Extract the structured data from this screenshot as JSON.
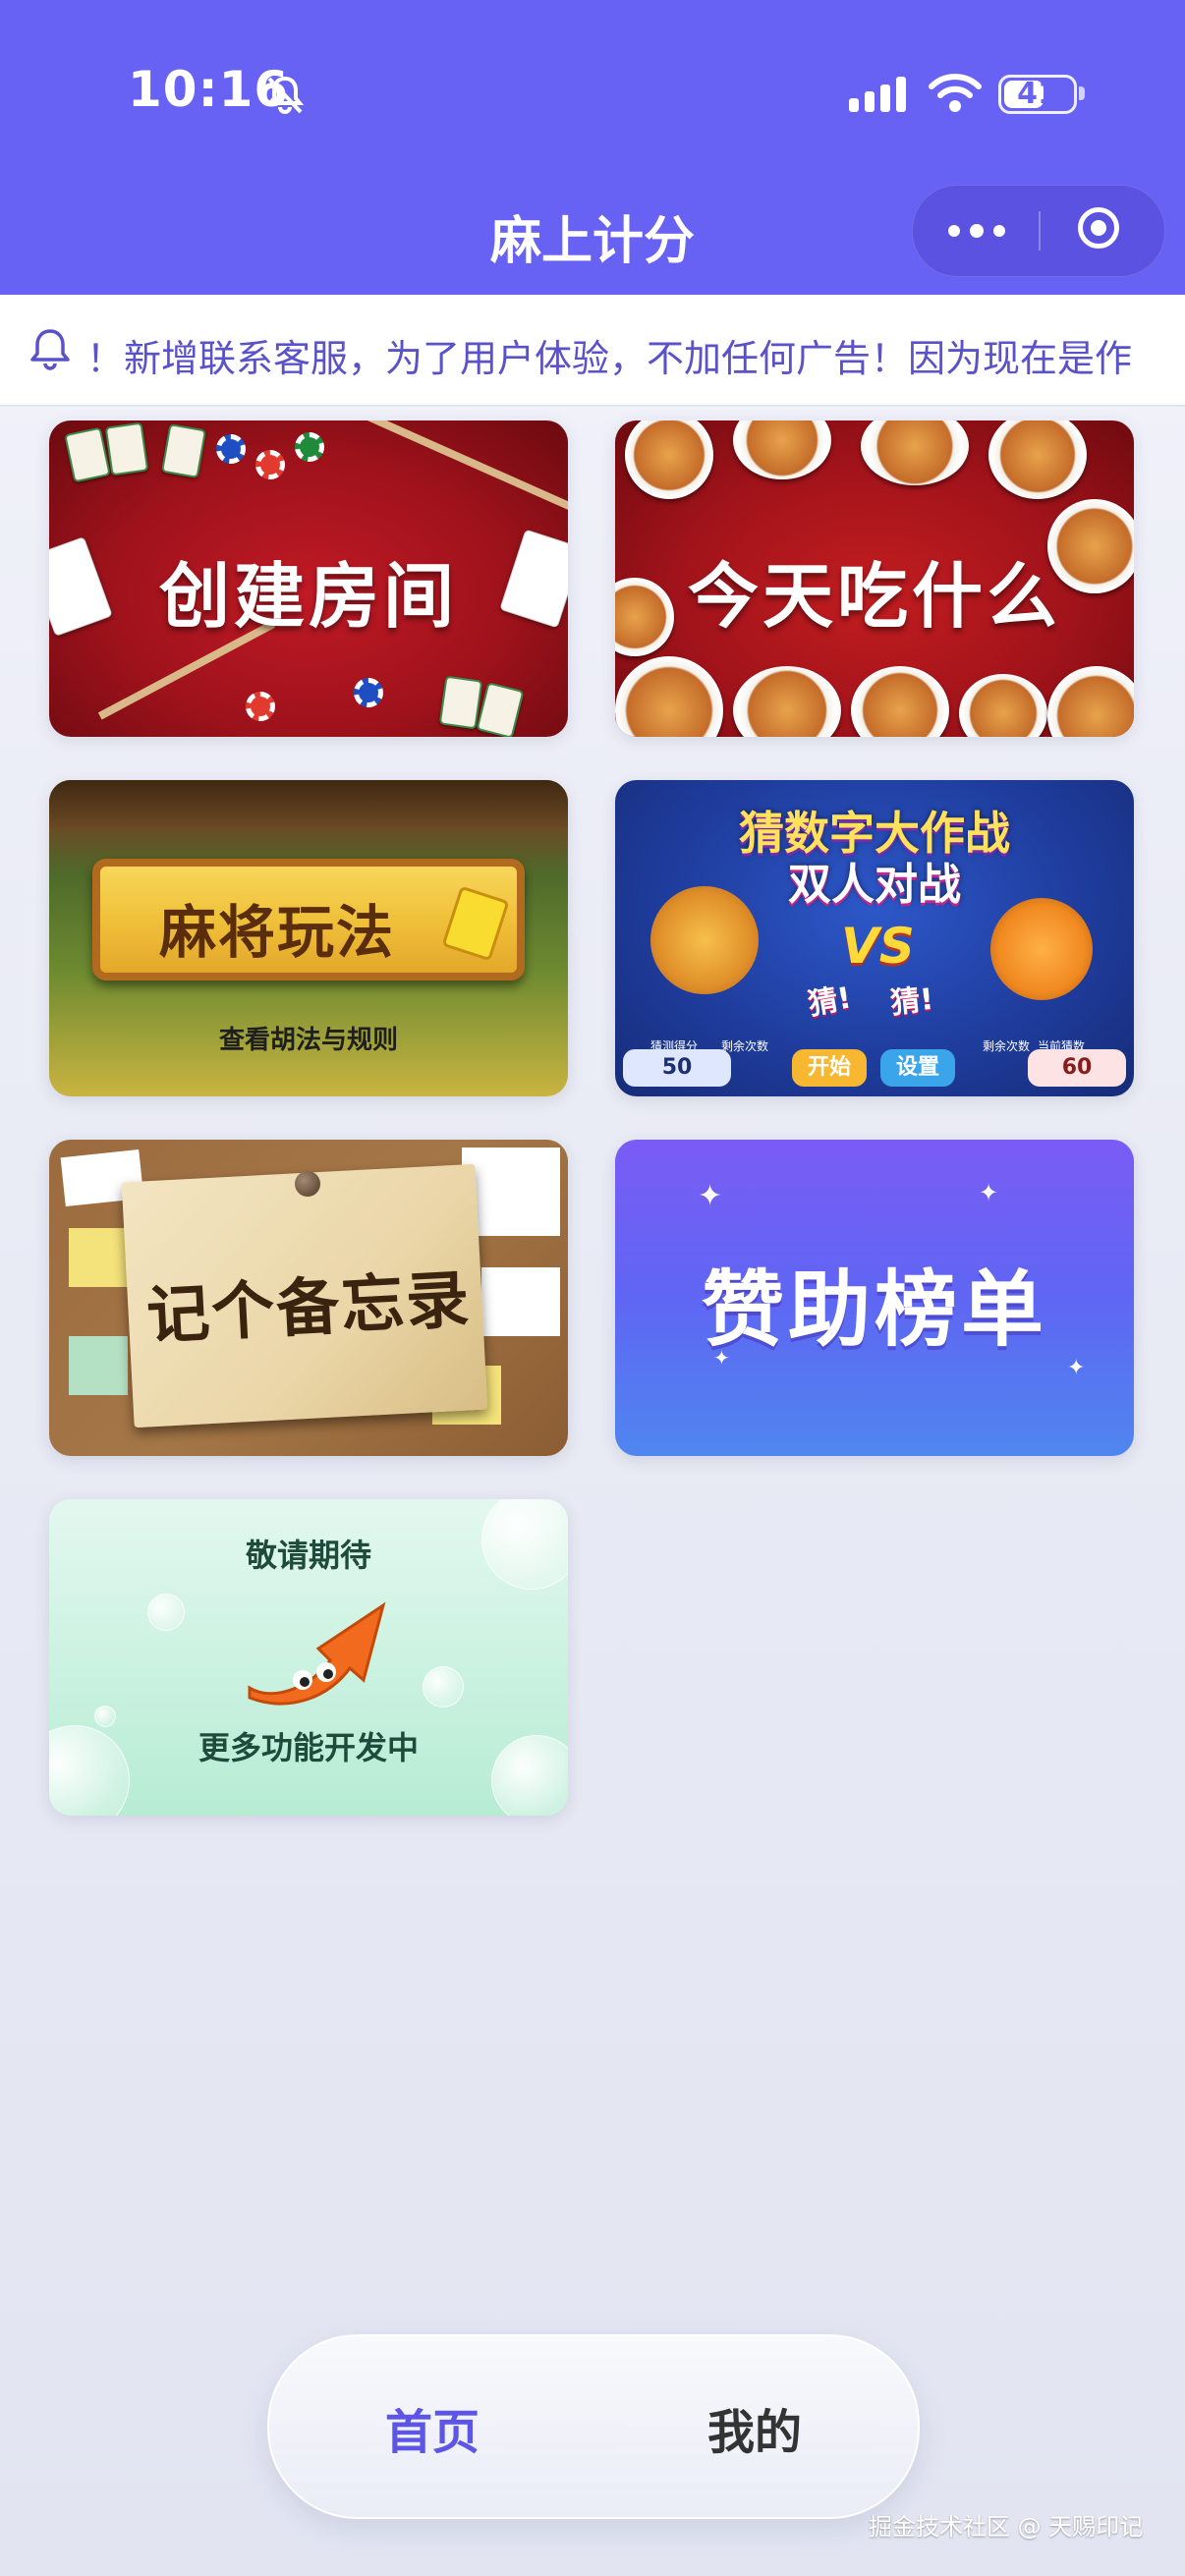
{
  "status_bar": {
    "time": "10:16",
    "battery": "41"
  },
  "app": {
    "title": "麻上计分"
  },
  "notice": {
    "text": "！新增联系客服，为了用户体验，不加任何广告！因为现在是作"
  },
  "cards": {
    "create_room": {
      "label": "创建房间"
    },
    "what_to_eat": {
      "label": "今天吃什么"
    },
    "mahjong_rules": {
      "label": "麻将玩法",
      "subtitle": "查看胡法与规则"
    },
    "guess_number": {
      "title_line1": "猜数字大作战",
      "title_line2": "双人对战",
      "vs": "VS",
      "guess1": "猜!",
      "guess2": "猜!",
      "left_caption": "猜测得分",
      "left_score": "50",
      "left_remaining": "剩余次数",
      "start": "开始",
      "settings": "设置",
      "right_remaining": "剩余次数",
      "right_caption": "当前猜数",
      "right_score": "60"
    },
    "memo": {
      "label": "记个备忘录"
    },
    "sponsor": {
      "label": "赞助榜单"
    },
    "coming_soon": {
      "top": "敬请期待",
      "bottom": "更多功能开发中"
    }
  },
  "tabbar": {
    "home": "首页",
    "me": "我的"
  },
  "watermark": "掘金技术社区 @ 天赐印记",
  "colors": {
    "primary": "#6862f4",
    "tab_active": "#5c55e6",
    "notice_text": "#5a52c8"
  },
  "icons": [
    "bell-off-icon",
    "signal-icon",
    "wifi-icon",
    "battery-icon",
    "more-icon",
    "close-miniprogram-icon",
    "bell-icon"
  ]
}
